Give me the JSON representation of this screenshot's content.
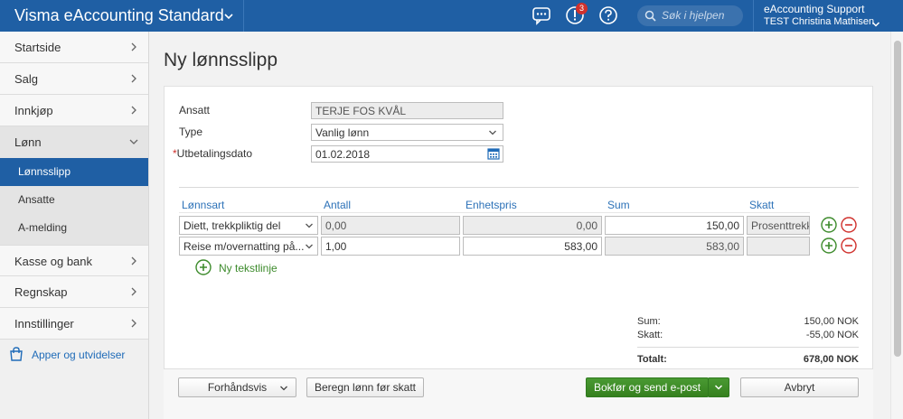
{
  "topbar": {
    "app_title": "Visma eAccounting Standard",
    "search_placeholder": "Søk i hjelpen",
    "notification_count": "3",
    "user_company": "eAccounting Support",
    "user_name": "TEST Christina Mathisen",
    "color": "#1f5fa4"
  },
  "sidebar": {
    "items": [
      {
        "label": "Startside"
      },
      {
        "label": "Salg"
      },
      {
        "label": "Innkjøp"
      },
      {
        "label": "Lønn"
      }
    ],
    "lonn_sub": [
      {
        "label": "Lønnsslipp"
      },
      {
        "label": "Ansatte"
      },
      {
        "label": "A-melding"
      }
    ],
    "items_after": [
      {
        "label": "Kasse og bank"
      },
      {
        "label": "Regnskap"
      },
      {
        "label": "Innstillinger"
      }
    ],
    "apps_label": "Apper og utvidelser"
  },
  "page": {
    "title": "Ny lønnsslipp"
  },
  "form": {
    "ansatt_label": "Ansatt",
    "ansatt_value": "TERJE FOS KVÅL",
    "type_label": "Type",
    "type_value": "Vanlig lønn",
    "required_mark": "*",
    "dato_label": "Utbetalingsdato",
    "dato_value": "01.02.2018"
  },
  "lines": {
    "headers": {
      "lonnsart": "Lønnsart",
      "antall": "Antall",
      "enhetspris": "Enhetspris",
      "sum": "Sum",
      "skatt": "Skatt"
    },
    "rows": [
      {
        "lonnsart": "Diett, trekkpliktig del",
        "antall": "0,00",
        "enhetspris": "0,00",
        "sum": "150,00",
        "skatt": "Prosenttrekk"
      },
      {
        "lonnsart": "Reise m/overnatting på...",
        "antall": "1,00",
        "enhetspris": "583,00",
        "sum": "583,00",
        "skatt": ""
      }
    ],
    "add_text_line": "Ny tekstlinje"
  },
  "totals": {
    "sum_label": "Sum:",
    "sum_value": "150,00 NOK",
    "skatt_label": "Skatt:",
    "skatt_value": "-55,00 NOK",
    "total_label": "Totalt:",
    "total_value": "678,00 NOK"
  },
  "footer": {
    "preview_label": "Forhåndsvis",
    "calc_label": "Beregn lønn før skatt",
    "book_send_label": "Bokfør og send e-post",
    "cancel_label": "Avbryt"
  },
  "colors": {
    "primary_blue": "#1f5fa4",
    "accent_green": "#3d8b2c",
    "danger_red": "#d0312d"
  }
}
